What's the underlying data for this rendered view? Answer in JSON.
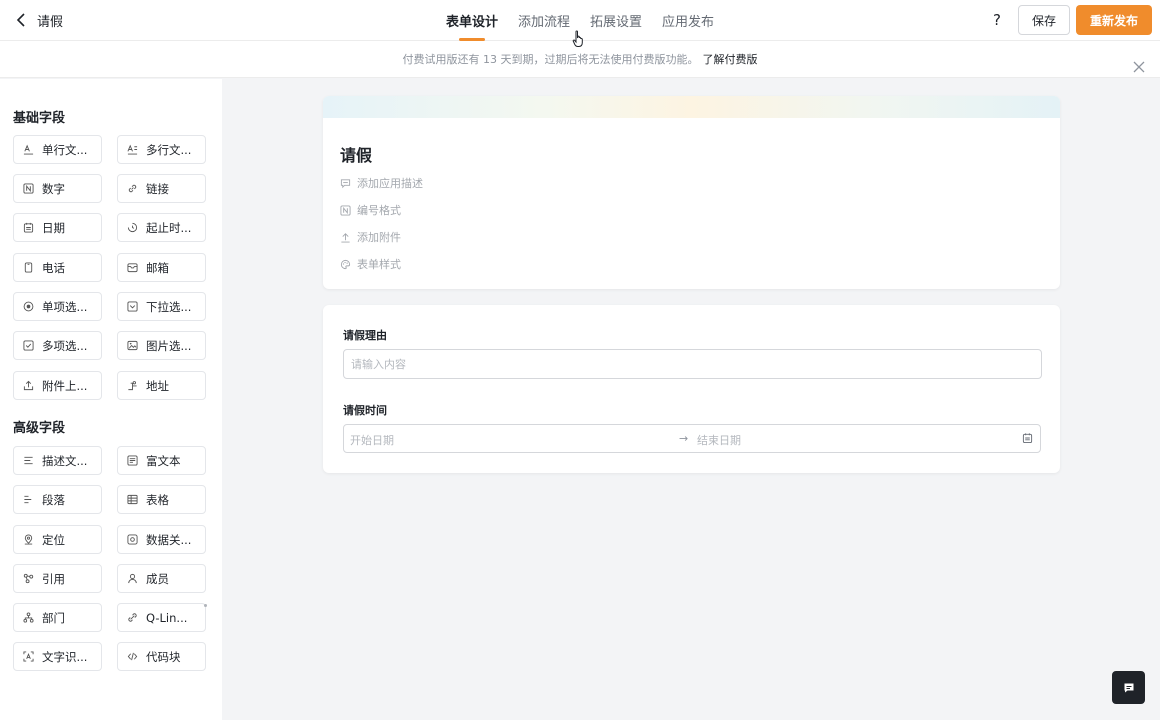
{
  "header": {
    "back_label": "",
    "title": "请假",
    "tabs": [
      {
        "label": "表单设计",
        "active": true
      },
      {
        "label": "添加流程",
        "active": false
      },
      {
        "label": "拓展设置",
        "active": false
      },
      {
        "label": "应用发布",
        "active": false
      }
    ],
    "help": "?",
    "save_label": "保存",
    "publish_label": "重新发布"
  },
  "banner": {
    "text": "付费试用版还有 13 天到期，过期后将无法使用付费版功能。",
    "link": "了解付费版"
  },
  "sidebar": {
    "basic_title": "基础字段",
    "basic": [
      {
        "label": "单行文...",
        "icon": "text-icon"
      },
      {
        "label": "多行文...",
        "icon": "multiline-text-icon"
      },
      {
        "label": "数字",
        "icon": "number-icon"
      },
      {
        "label": "链接",
        "icon": "link-icon"
      },
      {
        "label": "日期",
        "icon": "calendar-icon"
      },
      {
        "label": "起止时...",
        "icon": "time-range-icon"
      },
      {
        "label": "电话",
        "icon": "phone-icon"
      },
      {
        "label": "邮箱",
        "icon": "mail-icon"
      },
      {
        "label": "单项选...",
        "icon": "radio-icon"
      },
      {
        "label": "下拉选...",
        "icon": "dropdown-icon"
      },
      {
        "label": "多项选...",
        "icon": "checkbox-icon"
      },
      {
        "label": "图片选...",
        "icon": "image-icon"
      },
      {
        "label": "附件上...",
        "icon": "upload-icon"
      },
      {
        "label": "地址",
        "icon": "address-icon"
      }
    ],
    "advanced_title": "高级字段",
    "advanced": [
      {
        "label": "描述文...",
        "icon": "description-icon"
      },
      {
        "label": "富文本",
        "icon": "rich-text-icon"
      },
      {
        "label": "段落",
        "icon": "paragraph-icon"
      },
      {
        "label": "表格",
        "icon": "table-icon"
      },
      {
        "label": "定位",
        "icon": "location-icon"
      },
      {
        "label": "数据关...",
        "icon": "data-link-icon"
      },
      {
        "label": "引用",
        "icon": "reference-icon"
      },
      {
        "label": "成员",
        "icon": "member-icon"
      },
      {
        "label": "部门",
        "icon": "department-icon"
      },
      {
        "label": "Q-Lin...",
        "icon": "qlink-icon"
      },
      {
        "label": "文字识...",
        "icon": "ocr-icon"
      },
      {
        "label": "代码块",
        "icon": "code-icon"
      }
    ]
  },
  "form": {
    "title": "请假",
    "meta": [
      {
        "label": "添加应用描述",
        "icon": "comment-icon"
      },
      {
        "label": "编号格式",
        "icon": "number-format-icon"
      },
      {
        "label": "添加附件",
        "icon": "attachment-upload-icon"
      },
      {
        "label": "表单样式",
        "icon": "palette-icon"
      }
    ],
    "fields": {
      "reason_label": "请假理由",
      "reason_placeholder": "请输入内容",
      "time_label": "请假时间",
      "start_placeholder": "开始日期",
      "arrow": "→",
      "end_placeholder": "结束日期"
    }
  }
}
